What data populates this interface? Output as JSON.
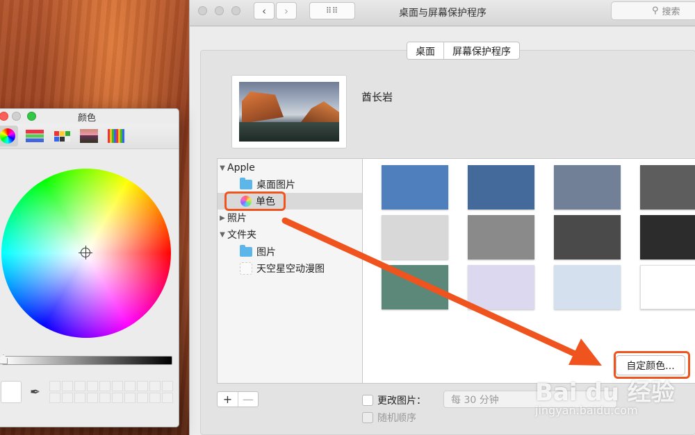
{
  "window": {
    "title": "桌面与屏幕保护程序",
    "search_placeholder": "搜索"
  },
  "tabs": [
    {
      "label": "桌面",
      "active": true
    },
    {
      "label": "屏幕保护程序",
      "active": false
    }
  ],
  "current_wallpaper": {
    "name": "酋长岩"
  },
  "sidebar": {
    "groups": [
      {
        "label": "Apple",
        "expanded": true,
        "items": [
          {
            "label": "桌面图片",
            "icon": "folder-icon"
          },
          {
            "label": "单色",
            "icon": "color-wheel-icon",
            "selected": true
          }
        ]
      },
      {
        "label": "照片",
        "expanded": false,
        "items": []
      },
      {
        "label": "文件夹",
        "expanded": true,
        "items": [
          {
            "label": "图片",
            "icon": "pictures-folder-icon"
          },
          {
            "label": "天空星空动漫图",
            "icon": "blank-folder-icon"
          }
        ]
      }
    ]
  },
  "swatches": [
    "#4f7fbc",
    "#446a9c",
    "#717f97",
    "#5d5d5d",
    "#d8d8d8",
    "#8a8a8a",
    "#4a4a4a",
    "#2c2c2c",
    "#5b8878",
    "#dcd8ef",
    "#d4e0ee",
    "#ffffff"
  ],
  "buttons": {
    "custom_color": "自定颜色...",
    "add": "+",
    "remove": "—"
  },
  "options": {
    "change_picture": "更改图片：",
    "change_interval": "每 30 分钟",
    "random_order": "随机顺序"
  },
  "colors_panel": {
    "title": "颜色",
    "modes": [
      "color-wheel",
      "color-sliders",
      "color-palettes",
      "image-palettes",
      "pencils"
    ],
    "brightness": 1.0
  },
  "watermark": {
    "brand": "Bai du 经验",
    "url": "jingyan.baidu.com"
  },
  "accent": "#f0541e"
}
